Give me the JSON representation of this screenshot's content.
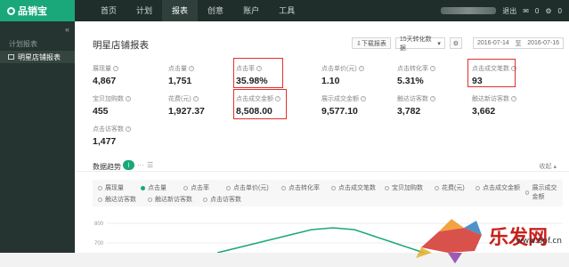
{
  "app": {
    "logo": "品销宝"
  },
  "nav": [
    {
      "label": "首页",
      "active": false
    },
    {
      "label": "计划",
      "active": false
    },
    {
      "label": "报表",
      "active": true
    },
    {
      "label": "创意",
      "active": false
    },
    {
      "label": "账户",
      "active": false
    },
    {
      "label": "工具",
      "active": false
    }
  ],
  "topRight": {
    "logout": "退出",
    "mailCount": "0",
    "settingsCount": "0"
  },
  "sidebar": {
    "sectionTitle": "计划报表",
    "activeItem": "明星店铺报表"
  },
  "page": {
    "title": "明星店铺报表",
    "downloadButton": "下载报表",
    "conversionSelect": "15天转化数据",
    "dateStart": "2016-07-14",
    "dateSeparator": "至",
    "dateEnd": "2016-07-16"
  },
  "metrics": [
    {
      "label": "展现量",
      "value": "4,867"
    },
    {
      "label": "点击量",
      "value": "1,751"
    },
    {
      "label": "点击率",
      "value": "35.98%"
    },
    {
      "label": "点击单价(元)",
      "value": "1.10"
    },
    {
      "label": "点击转化率",
      "value": "5.31%"
    },
    {
      "label": "点击成交笔数",
      "value": "93"
    },
    {
      "label": "宝贝加购数",
      "value": "455"
    },
    {
      "label": "花费(元)",
      "value": "1,927.37"
    },
    {
      "label": "点击成交金额",
      "value": "8,508.00"
    },
    {
      "label": "展示成交金额",
      "value": "9,577.10"
    },
    {
      "label": "触达访客数",
      "value": "3,782"
    },
    {
      "label": "触达新访客数",
      "value": "3,662"
    },
    {
      "label": "点击访客数",
      "value": "1,477"
    }
  ],
  "trend": {
    "title": "数据趋势",
    "collapse": "收起",
    "legend": [
      {
        "label": "展现量",
        "on": false
      },
      {
        "label": "点击量",
        "on": true
      },
      {
        "label": "点击率",
        "on": false
      },
      {
        "label": "点击单价(元)",
        "on": false
      },
      {
        "label": "点击转化率",
        "on": false
      },
      {
        "label": "点击成交笔数",
        "on": false
      },
      {
        "label": "宝贝加购数",
        "on": false
      },
      {
        "label": "花费(元)",
        "on": false
      },
      {
        "label": "点击成交金额",
        "on": false
      },
      {
        "label": "展示成交金额",
        "on": false
      },
      {
        "label": "触达访客数",
        "on": false
      },
      {
        "label": "触达新访客数",
        "on": false
      },
      {
        "label": "点击访客数",
        "on": false
      }
    ],
    "yTicks": [
      "800",
      "700"
    ]
  },
  "watermark": {
    "brand": "乐发网",
    "url": "www.6pf.cn"
  },
  "colors": {
    "accent": "#1aa77a",
    "highlight": "#e0302d",
    "topbar": "#1f2d2b",
    "sidebar": "#253331"
  }
}
